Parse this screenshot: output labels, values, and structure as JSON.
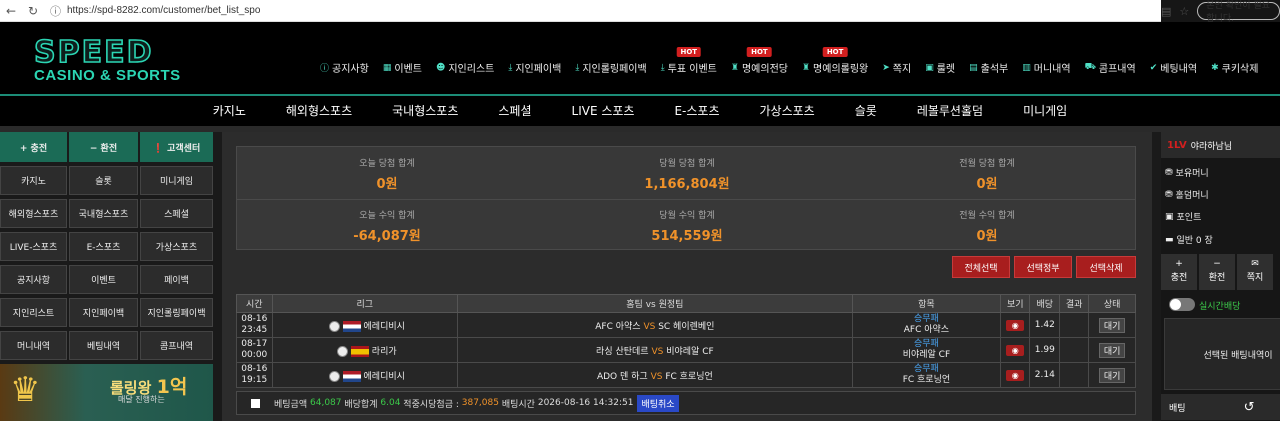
{
  "browser": {
    "url": "https://spd-8282.com/customer/bet_list_spo",
    "notice": "본인 확인이 필요합니다."
  },
  "logo": {
    "main": "SPEED",
    "sub": "CASINO & SPORTS"
  },
  "top_menu": [
    {
      "label": "공지사항",
      "icon": "info-icon",
      "hot": ""
    },
    {
      "label": "이벤트",
      "icon": "calendar-icon",
      "hot": ""
    },
    {
      "label": "지인리스트",
      "icon": "users-icon",
      "hot": ""
    },
    {
      "label": "지인페이백",
      "icon": "download-icon",
      "hot": ""
    },
    {
      "label": "지인롤링페이백",
      "icon": "download-icon",
      "hot": ""
    },
    {
      "label": "투표 이벤트",
      "icon": "download-icon",
      "hot": "HOT"
    },
    {
      "label": "명예의전당",
      "icon": "trophy-icon",
      "hot": "HOT"
    },
    {
      "label": "명예의롤링왕",
      "icon": "trophy-icon",
      "hot": "HOT"
    },
    {
      "label": "쪽지",
      "icon": "paper-plane-icon",
      "hot": ""
    },
    {
      "label": "룰렛",
      "icon": "gift-icon",
      "hot": ""
    },
    {
      "label": "출석부",
      "icon": "attendance-icon",
      "hot": ""
    },
    {
      "label": "머니내역",
      "icon": "money-icon",
      "hot": ""
    },
    {
      "label": "콤프내역",
      "icon": "car-icon",
      "hot": ""
    },
    {
      "label": "베팅내역",
      "icon": "check-icon",
      "hot": ""
    },
    {
      "label": "쿠키삭제",
      "icon": "cookie-icon",
      "hot": ""
    }
  ],
  "main_nav": [
    "카지노",
    "해외형스포츠",
    "국내형스포츠",
    "스페셜",
    "LIVE 스포츠",
    "E-스포츠",
    "가상스포츠",
    "슬롯",
    "레볼루션홀덤",
    "미니게임"
  ],
  "left_menu": {
    "top": [
      "+ 충전",
      "− 환전",
      "❗ 고객센터"
    ],
    "grid": [
      "카지노",
      "슬롯",
      "미니게임",
      "해외형스포츠",
      "국내형스포츠",
      "스페셜",
      "LIVE-스포츠",
      "E-스포츠",
      "가상스포츠",
      "공지사항",
      "이벤트",
      "페이백",
      "지인리스트",
      "지인페이백",
      "지인롤링페이백",
      "머니내역",
      "베팅내역",
      "콤프내역"
    ]
  },
  "banner": {
    "title": "롤링왕",
    "num": "1억",
    "sub": "매달 진행하는"
  },
  "stats": [
    {
      "label": "오늘 당첨 합계",
      "value": "0원"
    },
    {
      "label": "당월 당첨 합계",
      "value": "1,166,804원"
    },
    {
      "label": "전월 당첨 합계",
      "value": "0원"
    },
    {
      "label": "오늘 수익 합계",
      "value": "-64,087원"
    },
    {
      "label": "당월 수익 합계",
      "value": "514,559원"
    },
    {
      "label": "전월 수익 합계",
      "value": "0원"
    }
  ],
  "actions": [
    "전체선택",
    "선택정부",
    "선택삭제"
  ],
  "table": {
    "headers": [
      "시간",
      "리그",
      "홈팀 vs 원정팀",
      "항목",
      "보기",
      "배당",
      "결과",
      "상태"
    ],
    "rows": [
      {
        "date": "08-16",
        "time": "23:45",
        "flag": "nl",
        "league": "에레디비시",
        "home": "AFC 아약스",
        "vs": "VS",
        "away": "SC 헤이렌베인",
        "pick_type": "승무패",
        "pick": "AFC 아약스",
        "odds": "1.42",
        "result": "",
        "status": "대기"
      },
      {
        "date": "08-17",
        "time": "00:00",
        "flag": "es",
        "league": "라리가",
        "home": "라싱 산탄데르",
        "vs": "VS",
        "away": "비야레알 CF",
        "pick_type": "승무패",
        "pick": "비야레알 CF",
        "odds": "1.99",
        "result": "",
        "status": "대기"
      },
      {
        "date": "08-16",
        "time": "19:15",
        "flag": "nl",
        "league": "에레디비시",
        "home": "ADO 덴 하그",
        "vs": "VS",
        "away": "FC 흐로닝언",
        "pick_type": "승무패",
        "pick": "FC 흐로닝언",
        "odds": "2.14",
        "result": "",
        "status": "대기"
      }
    ]
  },
  "footer": {
    "amount_label": "베팅금액",
    "amount": "64,087",
    "total_label": "배당합계",
    "total": "6.04",
    "win_label": "적중시당첨금 :",
    "win": "387,085",
    "time_label": "배팅시간",
    "time": "2026-08-16 14:32:51",
    "cancel": "배팅취소"
  },
  "right": {
    "badge": "1LV",
    "user": "야라하남님",
    "items": [
      "보유머니",
      "홀덤머니",
      "포인트",
      "일반 0 장"
    ],
    "buttons": [
      "충전",
      "환전",
      "쪽지"
    ],
    "toggle_label": "실시간배당",
    "selected": "선택된 배팅내역이",
    "bet_label": "배팅"
  }
}
